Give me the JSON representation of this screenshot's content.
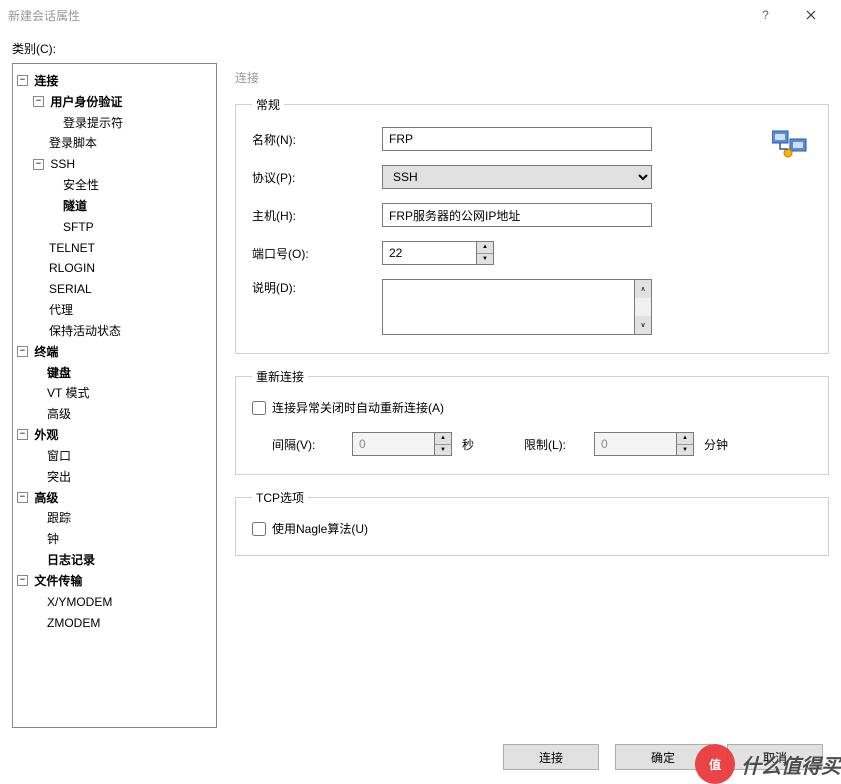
{
  "window": {
    "title": "新建会话属性",
    "help_icon": "?",
    "close_icon": "✕"
  },
  "category_label": "类别(C):",
  "panel_title": "连接",
  "tree": {
    "conn": "连接",
    "auth": "用户身份验证",
    "login_prompt": "登录提示符",
    "login_script": "登录脚本",
    "ssh": "SSH",
    "security": "安全性",
    "tunnel": "隧道",
    "sftp": "SFTP",
    "telnet": "TELNET",
    "rlogin": "RLOGIN",
    "serial": "SERIAL",
    "proxy": "代理",
    "keepalive": "保持活动状态",
    "terminal": "终端",
    "keyboard": "键盘",
    "vtmode": "VT 模式",
    "adv": "高级",
    "appearance": "外观",
    "window": "窗口",
    "highlight": "突出",
    "advanced": "高级",
    "trace": "跟踪",
    "bell": "钟",
    "logging": "日志记录",
    "filetrans": "文件传输",
    "xymodem": "X/YMODEM",
    "zmodem": "ZMODEM"
  },
  "groups": {
    "general": "常规",
    "reconnect": "重新连接",
    "tcp": "TCP选项"
  },
  "labels": {
    "name": "名称(N):",
    "protocol": "协议(P):",
    "host": "主机(H):",
    "port": "端口号(O):",
    "desc": "说明(D):",
    "auto_reconnect": "连接异常关闭时自动重新连接(A)",
    "interval": "间隔(V):",
    "seconds": "秒",
    "limit": "限制(L):",
    "minutes": "分钟",
    "nagle": "使用Nagle算法(U)"
  },
  "values": {
    "name": "FRP",
    "protocol": "SSH",
    "host": "FRP服务器的公网IP地址",
    "port": "22",
    "desc": "",
    "interval": "0",
    "limit": "0"
  },
  "buttons": {
    "connect": "连接",
    "ok": "确定",
    "cancel": "取消"
  },
  "watermark": {
    "text": "什么值得买",
    "badge": "值"
  }
}
